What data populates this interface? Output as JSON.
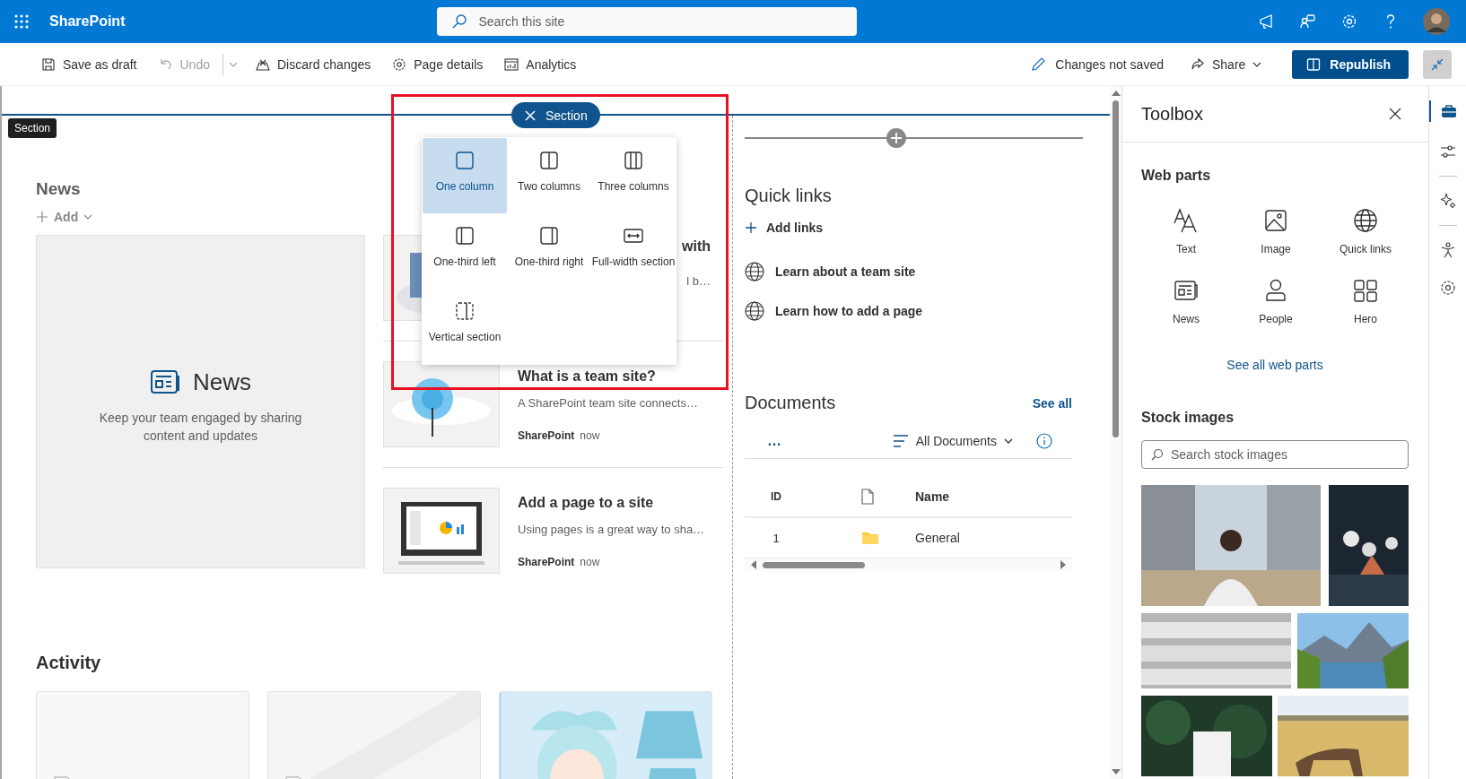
{
  "header": {
    "app_name": "SharePoint",
    "search_placeholder": "Search this site"
  },
  "command_bar": {
    "items": [
      {
        "label": "Save as draft",
        "disabled": false
      },
      {
        "label": "Undo",
        "disabled": true
      },
      {
        "label": "Discard changes",
        "disabled": false
      },
      {
        "label": "Page details",
        "disabled": false
      },
      {
        "label": "Analytics",
        "disabled": false
      }
    ],
    "status": "Changes not saved",
    "share": "Share",
    "publish": "Republish"
  },
  "section_tooltip": "Section",
  "section_menu": {
    "title": "Section",
    "options": [
      {
        "label": "One column",
        "selected": true
      },
      {
        "label": "Two columns",
        "selected": false
      },
      {
        "label": "Three columns",
        "selected": false
      },
      {
        "label": "One-third left",
        "selected": false
      },
      {
        "label": "One-third right",
        "selected": false
      },
      {
        "label": "Full-width section",
        "selected": false
      },
      {
        "label": "Vertical section",
        "selected": false
      }
    ]
  },
  "news": {
    "title": "News",
    "add": "Add",
    "placeholder_title": "News",
    "placeholder_text": "Keep your team engaged by sharing content and updates",
    "items": [
      {
        "title": "with",
        "description": "l b…"
      },
      {
        "title": "What is a team site?",
        "description": "A SharePoint team site connects…",
        "source": "SharePoint",
        "time": "now"
      },
      {
        "title": "Add a page to a site",
        "description": "Using pages is a great way to sha…",
        "source": "SharePoint",
        "time": "now"
      }
    ]
  },
  "quick_links": {
    "title": "Quick links",
    "add": "Add links",
    "items": [
      "Learn about a team site",
      "Learn how to add a page"
    ]
  },
  "documents": {
    "title": "Documents",
    "see_all": "See all",
    "more": "…",
    "view": "All Documents",
    "columns": [
      "ID",
      "Name"
    ],
    "rows": [
      {
        "id": "1",
        "name": "General"
      }
    ]
  },
  "activity": {
    "title": "Activity",
    "cards": [
      {
        "kind": "document"
      },
      {
        "kind": "document"
      },
      {
        "kind": "picture"
      }
    ]
  },
  "toolbox": {
    "title": "Toolbox",
    "web_parts_title": "Web parts",
    "web_parts": [
      "Text",
      "Image",
      "Quick links",
      "News",
      "People",
      "Hero"
    ],
    "see_all": "See all web parts",
    "stock_title": "Stock images",
    "stock_placeholder": "Search stock images",
    "images": [
      {
        "kind": "picture"
      },
      {
        "kind": "picture"
      },
      {
        "kind": "picture"
      },
      {
        "kind": "picture"
      },
      {
        "kind": "picture"
      },
      {
        "kind": "picture"
      }
    ]
  }
}
